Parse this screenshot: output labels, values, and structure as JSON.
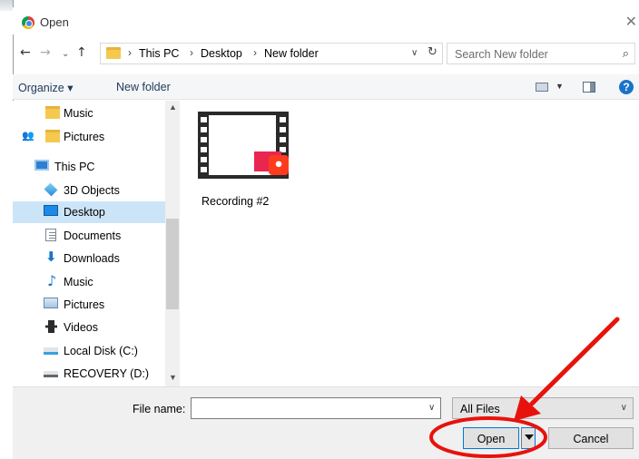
{
  "window": {
    "title": "Open",
    "close_glyph": "✕"
  },
  "address": {
    "breadcrumbs": [
      "This PC",
      "Desktop",
      "New folder"
    ],
    "separator": "›",
    "search_placeholder": "Search New folder"
  },
  "toolbar": {
    "organize_label": "Organize ▾",
    "new_folder_label": "New folder",
    "help_glyph": "?"
  },
  "nav_items": [
    {
      "label": "Music",
      "icon": "folder-icon"
    },
    {
      "label": "Pictures",
      "icon": "folder-icon"
    },
    {
      "label": "This PC",
      "icon": "computer-icon"
    },
    {
      "label": "3D Objects",
      "icon": "3d-objects-icon"
    },
    {
      "label": "Desktop",
      "icon": "desktop-icon",
      "selected": true
    },
    {
      "label": "Documents",
      "icon": "documents-icon"
    },
    {
      "label": "Downloads",
      "icon": "downloads-icon"
    },
    {
      "label": "Music",
      "icon": "music-icon"
    },
    {
      "label": "Pictures",
      "icon": "pictures-icon"
    },
    {
      "label": "Videos",
      "icon": "videos-icon"
    },
    {
      "label": "Local Disk (C:)",
      "icon": "local-disk-icon"
    },
    {
      "label": "RECOVERY (D:)",
      "icon": "recovery-drive-icon"
    }
  ],
  "files": [
    {
      "name": "Recording #2",
      "icon": "video-thumbnail-icon"
    }
  ],
  "bottom": {
    "file_name_label": "File name:",
    "file_name_value": "",
    "file_type": "All Files",
    "open_label": "Open",
    "cancel_label": "Cancel"
  },
  "colors": {
    "accent": "#0078d7",
    "selection": "#cce4f7",
    "annotation": "#e8120c"
  }
}
